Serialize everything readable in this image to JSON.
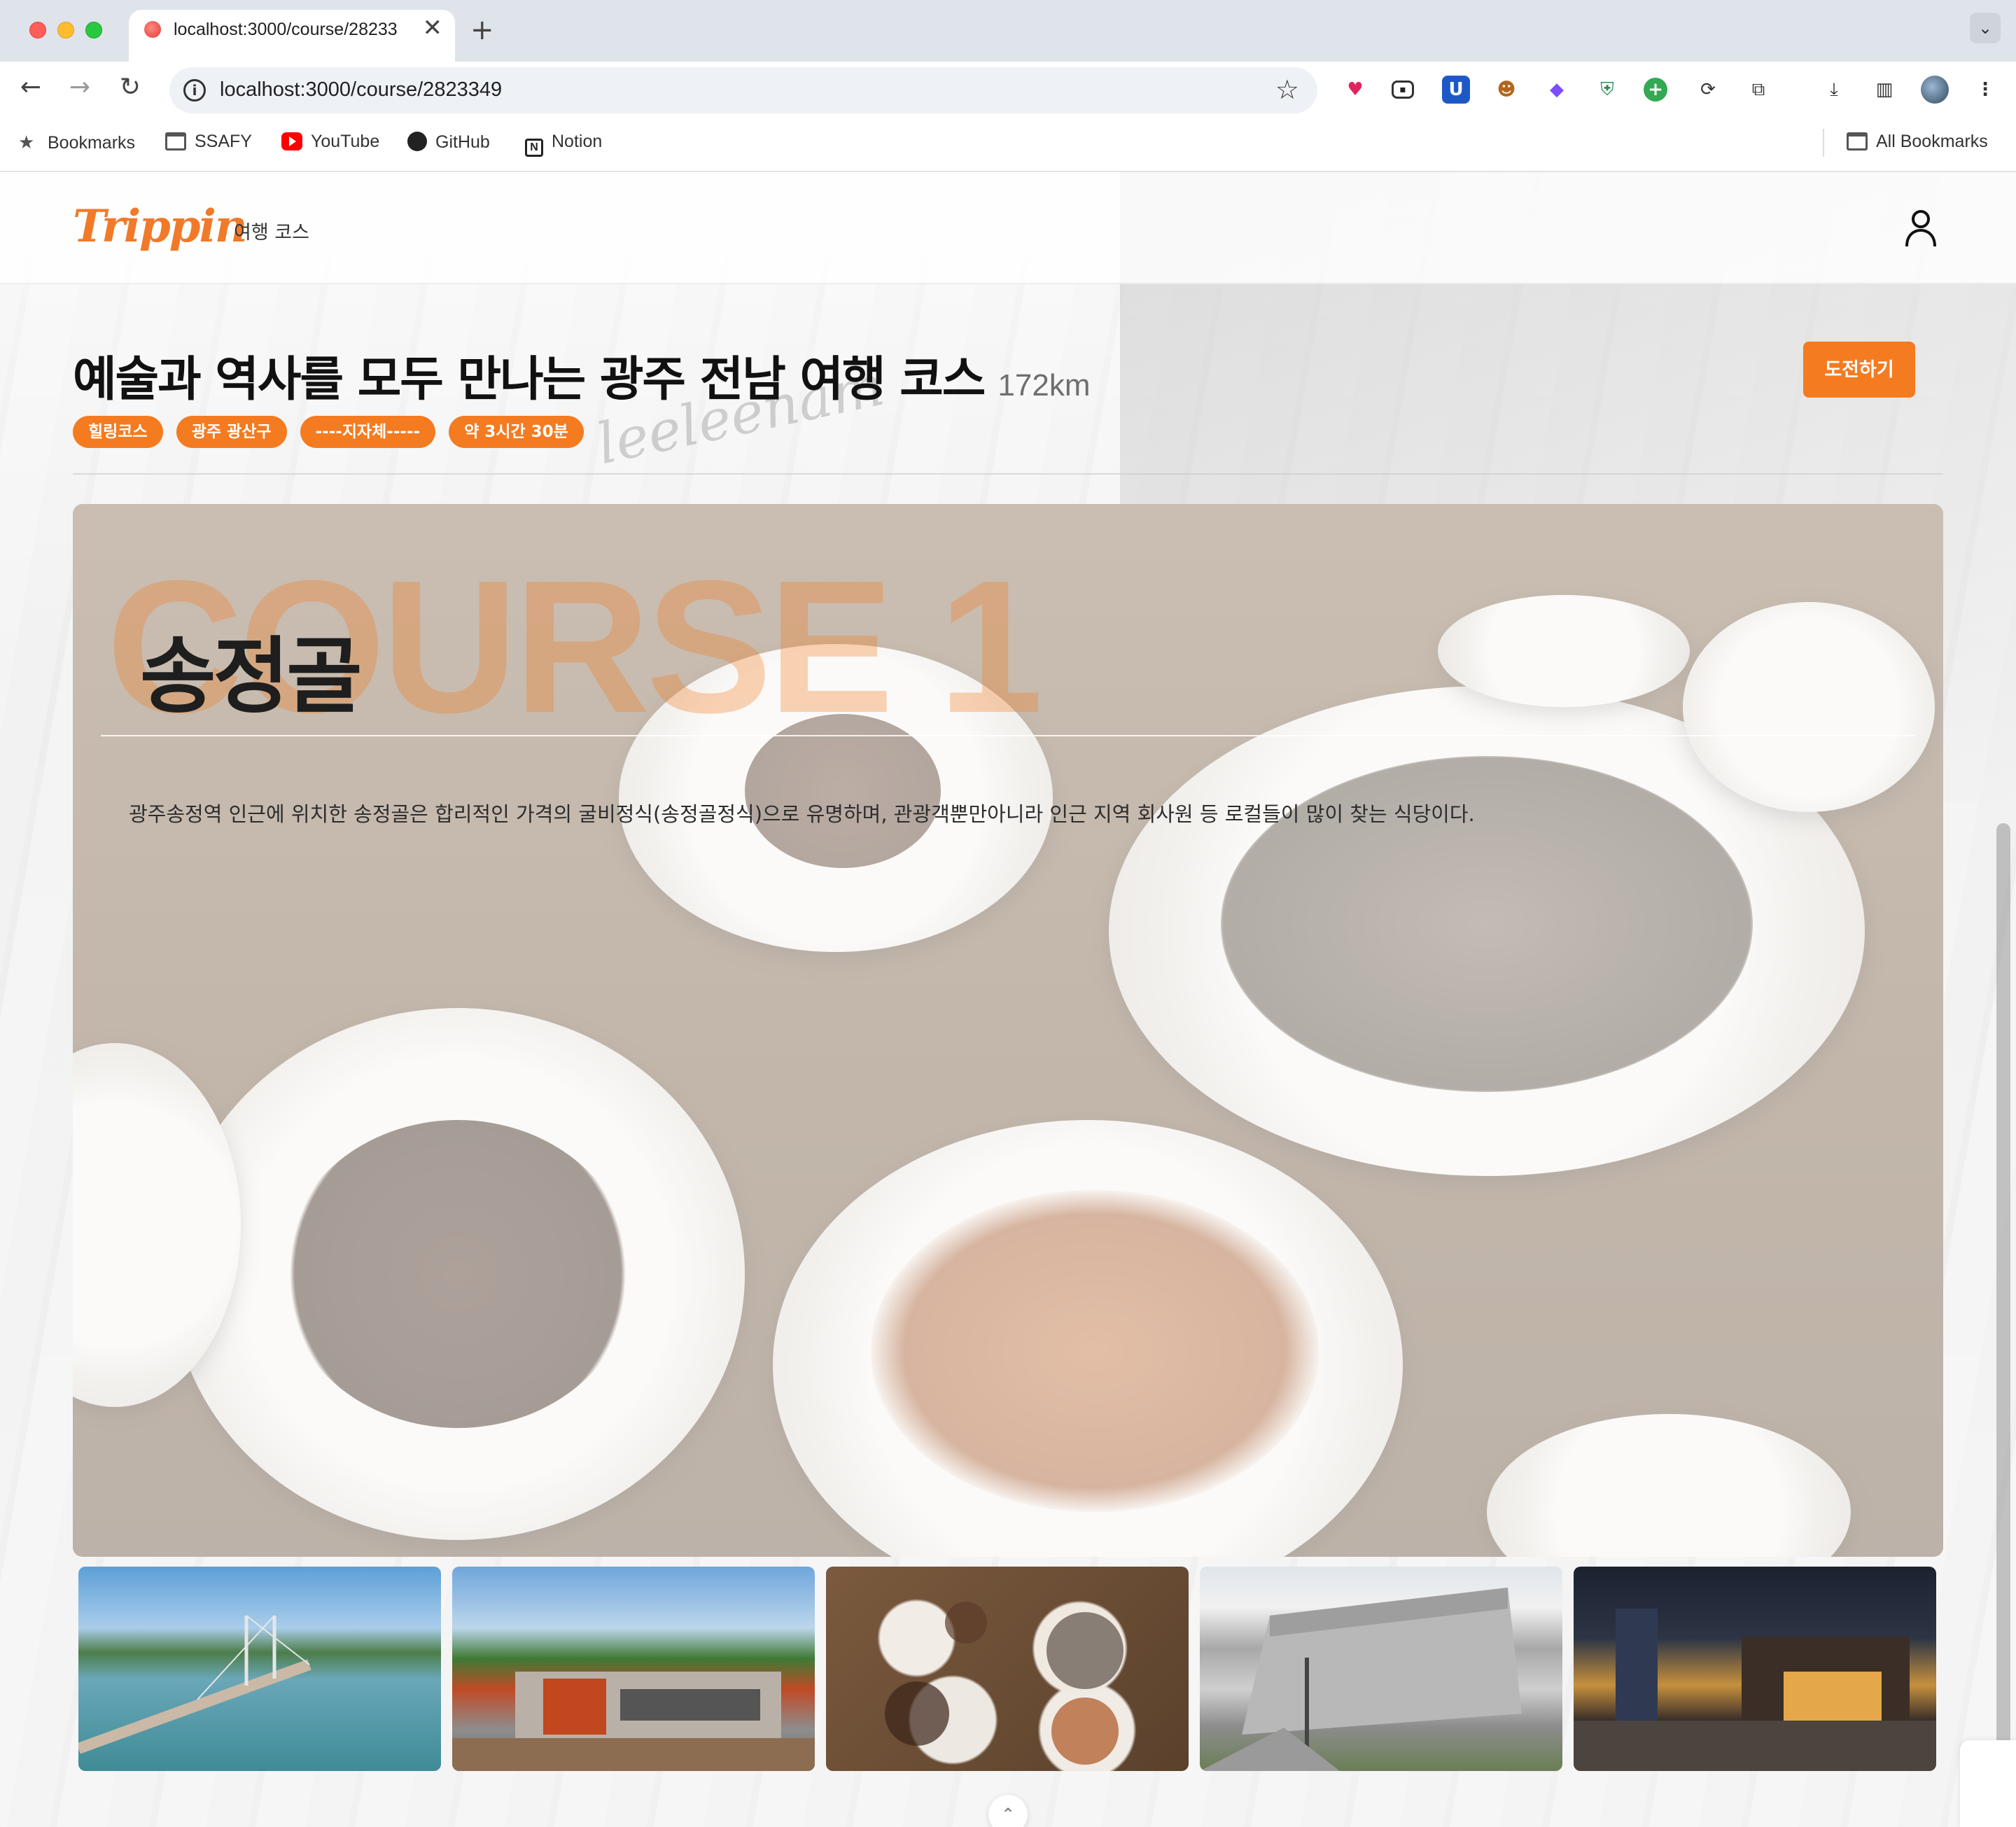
{
  "browser": {
    "tab_title": "localhost:3000/course/2823349",
    "tab_close": "✕",
    "new_tab": "+",
    "tab_menu": "⌄",
    "url": "localhost:3000/course/2823349",
    "bookmarks": [
      {
        "label": "Bookmarks",
        "icon": "star-icon"
      },
      {
        "label": "SSAFY",
        "icon": "folder-icon"
      },
      {
        "label": "YouTube",
        "icon": "youtube-icon"
      },
      {
        "label": "GitHub",
        "icon": "github-icon"
      },
      {
        "label": "Notion",
        "icon": "notion-icon"
      }
    ],
    "all_bookmarks": "All Bookmarks"
  },
  "header": {
    "logo": "Trippin",
    "nav_course": "여행 코스"
  },
  "course": {
    "title": "예술과 역사를 모두 만나는 광주 전남 여행 코스",
    "distance": "172km",
    "challenge_label": "도전하기",
    "tags": [
      "힐링코스",
      "광주 광산구",
      "----지자체-----",
      "약 3시간 30분"
    ]
  },
  "hero": {
    "watermark": "COURSE 1",
    "place_name": "송정골",
    "description": "광주송정역 인근에 위치한 송정골은 합리적인 가격의 굴비정식(송정골정식)으로 유명하며, 관광객뿐만아니라 인근 지역 회사원 등 로컬들이 많이 찾는 식당이다."
  },
  "thumbnails": [
    {
      "name": "bridge-island-photo"
    },
    {
      "name": "museum-building-photo"
    },
    {
      "name": "restaurant-food-photo"
    },
    {
      "name": "silver-building-photo"
    },
    {
      "name": "night-street-photo"
    }
  ],
  "colors": {
    "accent": "#f47b20",
    "logo": "#f07a2a"
  }
}
